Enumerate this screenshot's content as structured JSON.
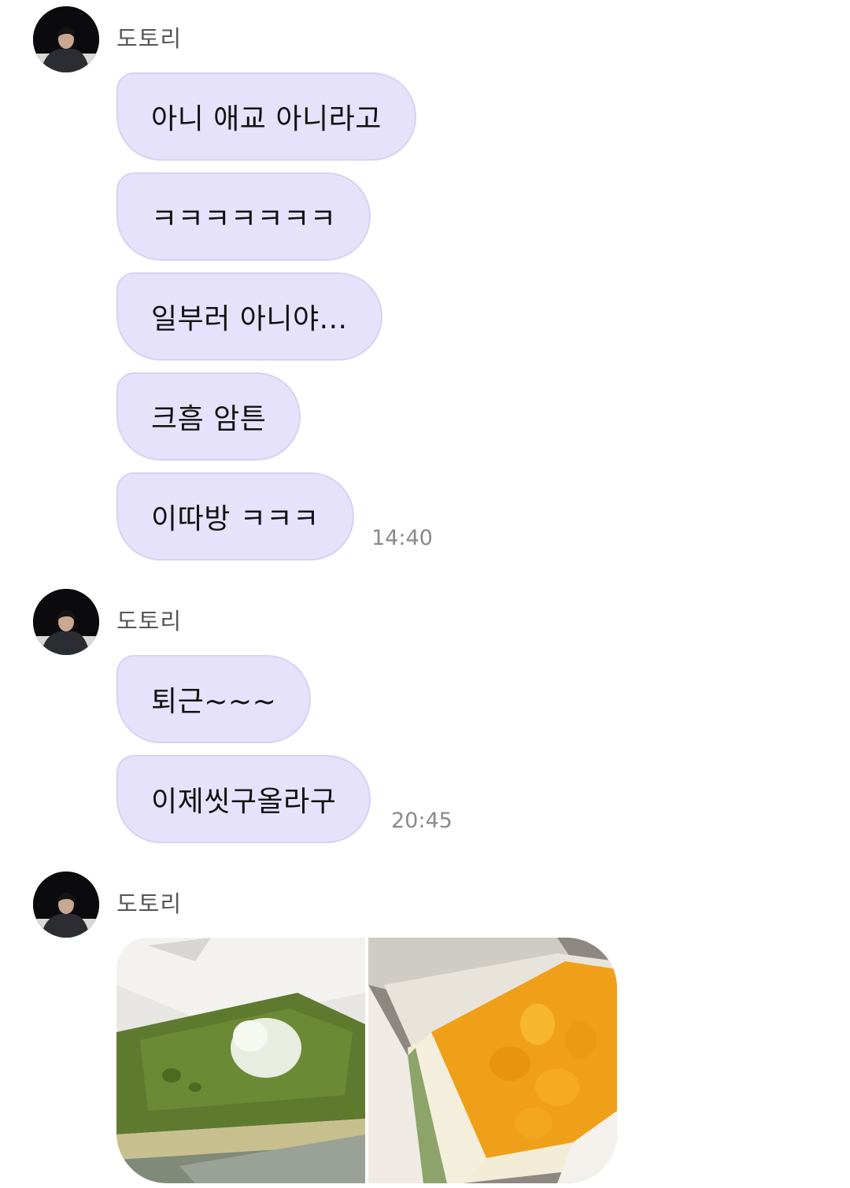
{
  "groups": [
    {
      "sender": "도토리",
      "messages": [
        "아니 애교 아니라고",
        "ㅋㅋㅋㅋㅋㅋㅋ",
        "일부러 아니야...",
        "크흠 암튼",
        "이따방 ㅋㅋㅋ"
      ],
      "time": "14:40"
    },
    {
      "sender": "도토리",
      "messages": [
        "퇴근~~~",
        "이제씻구올라구"
      ],
      "time": "20:45"
    },
    {
      "sender": "도토리",
      "photos": [
        "matcha-cake-photo",
        "mango-cheesecake-photo"
      ]
    }
  ],
  "colors": {
    "bubble": "#e6e2fb",
    "bubble_border": "#d7d2f2",
    "sender_text": "#555555",
    "time_text": "#8a8a8a"
  }
}
